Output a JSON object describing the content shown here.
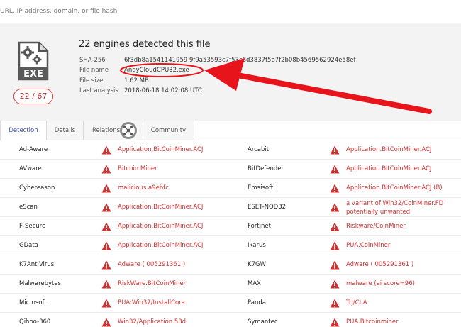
{
  "search": {
    "placeholder": "URL, IP address, domain, or file hash"
  },
  "file_icon": {
    "label": "EXE",
    "icon": "gears-icon"
  },
  "score": {
    "detected": "22",
    "total": "67",
    "text": "22 / 67"
  },
  "summary": {
    "title": "22 engines detected this file",
    "rows": [
      {
        "key": "SHA-256",
        "value": "6f3db8a1541141959 9f9a53593c7f53c8d3837f5e7f2b08b4569562924e58ef"
      },
      {
        "key": "File name",
        "value": "AndyCloudCPU32.exe"
      },
      {
        "key": "File size",
        "value": "1.62 MB"
      },
      {
        "key": "Last analysis",
        "value": "2018-06-18 14:02:08 UTC"
      }
    ]
  },
  "tabs": [
    {
      "label": "Detection"
    },
    {
      "label": "Details"
    },
    {
      "label": "Relations"
    },
    {
      "label": "Community"
    }
  ],
  "colors": {
    "accent": "#3949ab",
    "danger": "#d32f2f",
    "arrow": "#e8141c"
  },
  "detections": [
    {
      "left": {
        "engine": "Ad-Aware",
        "result": "Application.BitCoinMiner.ACJ"
      },
      "right": {
        "engine": "Arcabit",
        "result": "Application.BitCoinMiner.ACJ"
      }
    },
    {
      "left": {
        "engine": "AVware",
        "result": "Bitcoin Miner"
      },
      "right": {
        "engine": "BitDefender",
        "result": "Application.BitCoinMiner.ACJ"
      }
    },
    {
      "left": {
        "engine": "Cybereason",
        "result": "malicious.a9ebfc"
      },
      "right": {
        "engine": "Emsisoft",
        "result": "Application.BitCoinMiner.ACJ (B)"
      }
    },
    {
      "left": {
        "engine": "eScan",
        "result": "Application.BitCoinMiner.ACJ"
      },
      "right": {
        "engine": "ESET-NOD32",
        "result": "a variant of Win32/CoinMiner.FD potentially unwanted"
      }
    },
    {
      "left": {
        "engine": "F-Secure",
        "result": "Application.BitCoinMiner.ACJ"
      },
      "right": {
        "engine": "Fortinet",
        "result": "Riskware/CoinMiner"
      }
    },
    {
      "left": {
        "engine": "GData",
        "result": "Application.BitCoinMiner.ACJ"
      },
      "right": {
        "engine": "Ikarus",
        "result": "PUA.CoinMiner"
      }
    },
    {
      "left": {
        "engine": "K7AntiVirus",
        "result": "Adware ( 005291361 )"
      },
      "right": {
        "engine": "K7GW",
        "result": "Adware ( 005291361 )"
      }
    },
    {
      "left": {
        "engine": "Malwarebytes",
        "result": "RiskWare.BitCoinMiner"
      },
      "right": {
        "engine": "MAX",
        "result": "malware (ai score=96)"
      }
    },
    {
      "left": {
        "engine": "Microsoft",
        "result": "PUA:Win32/InstallCore"
      },
      "right": {
        "engine": "Panda",
        "result": "Trj/CI.A"
      }
    },
    {
      "left": {
        "engine": "Qihoo-360",
        "result": "Win32/Application.53d"
      },
      "right": {
        "engine": "Symantec",
        "result": "PUA.Bitcoinminer"
      }
    }
  ]
}
